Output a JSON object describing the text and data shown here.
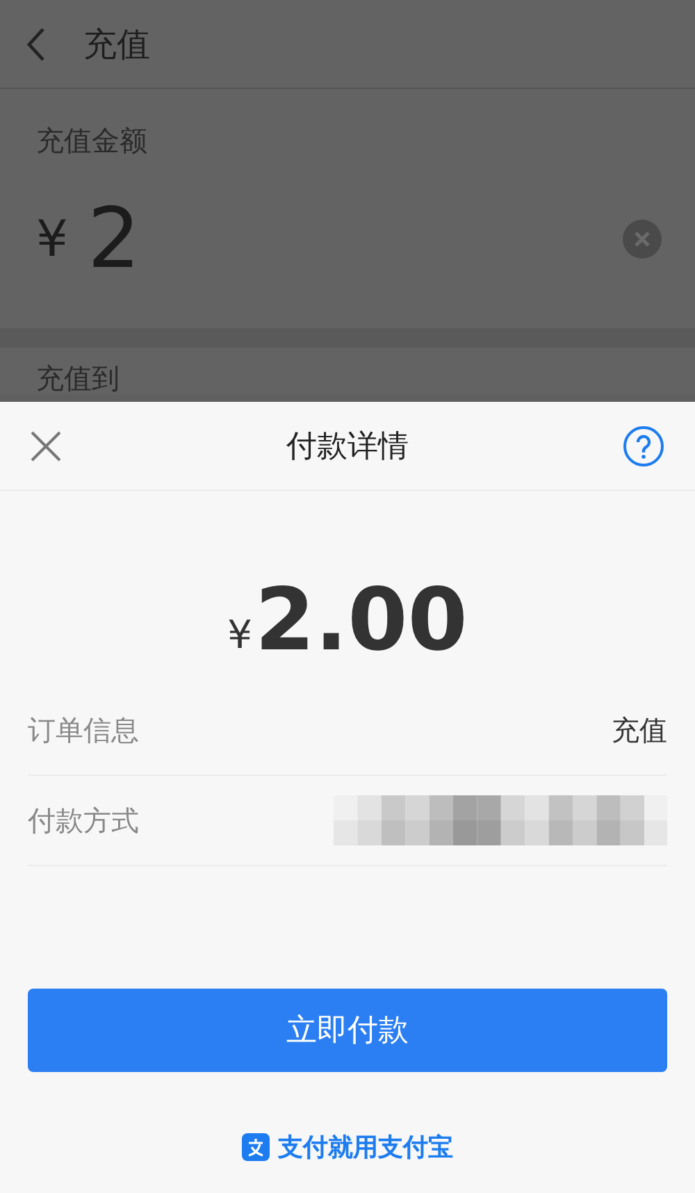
{
  "background_page": {
    "title": "充值",
    "amount_label": "充值金额",
    "currency": "¥",
    "amount": "2",
    "section_label": "充值到"
  },
  "payment_sheet": {
    "title": "付款详情",
    "currency": "¥",
    "amount": "2.00",
    "rows": [
      {
        "kind": "text",
        "label": "订单信息",
        "value": "充值"
      },
      {
        "kind": "redacted",
        "label": "付款方式"
      }
    ],
    "pay_button": "立即付款",
    "footer": "支付就用支付宝"
  }
}
